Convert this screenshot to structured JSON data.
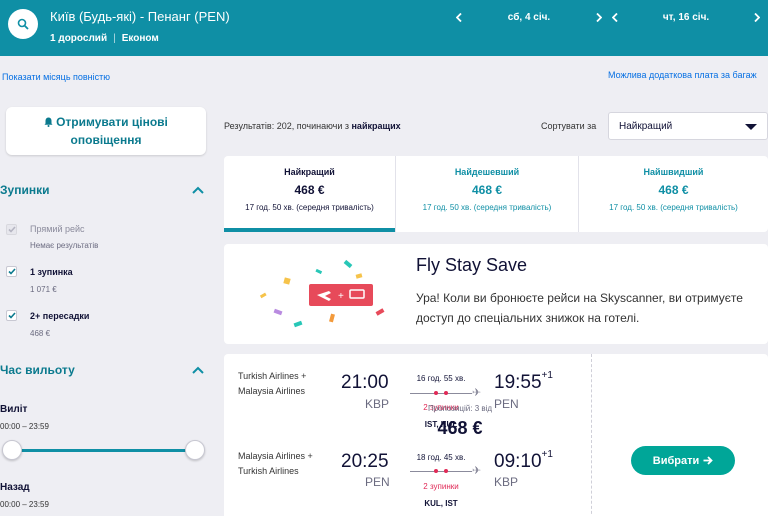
{
  "header": {
    "route": "Київ (Будь-які) - Пенанг (PEN)",
    "passengers": "1 дорослий",
    "cabin": "Економ",
    "outbound_date": "сб, 4 січ.",
    "return_date": "чт, 16 січ."
  },
  "links": {
    "show_month": "Показати місяць повністю",
    "bag_fees": "Можлива додаткова плата за багаж"
  },
  "sidebar": {
    "alert_button": "Отримувати цінові оповіщення",
    "stops_title": "Зупинки",
    "stops": [
      {
        "label": "Прямий рейс",
        "sub": "Немає результатів",
        "checked": true,
        "disabled": true
      },
      {
        "label": "1 зупинка",
        "sub": "1 071 €",
        "checked": true,
        "disabled": false
      },
      {
        "label": "2+ пересадки",
        "sub": "468 €",
        "checked": true,
        "disabled": false
      }
    ],
    "departure_title": "Час вильоту",
    "outbound_label": "Виліт",
    "outbound_range": "00:00 – 23:59",
    "return_label": "Назад",
    "return_range": "00:00 – 23:59"
  },
  "results": {
    "count_prefix": "Результатів: 202, починаючи з ",
    "count_bold": "найкращих",
    "sort_label": "Сортувати за",
    "sort_value": "Найкращий"
  },
  "tabs": [
    {
      "name": "Найкращий",
      "price": "468 €",
      "duration": "17 год. 50 хв. (середня тривалість)"
    },
    {
      "name": "Найдешевший",
      "price": "468 €",
      "duration": "17 год. 50 хв. (середня тривалість)"
    },
    {
      "name": "Найшвидший",
      "price": "468 €",
      "duration": "17 год. 50 хв. (середня тривалість)"
    }
  ],
  "promo": {
    "title": "Fly Stay Save",
    "text": "Ура! Коли ви бронюєте рейси на Skyscanner, ви отримуєте доступ до спеціальних знижок на готелі."
  },
  "result": {
    "legs": [
      {
        "airline": "Turkish Airlines + Malaysia Airlines",
        "dep_time": "21:00",
        "dep_code": "KBP",
        "duration": "16 год. 55 хв.",
        "stops": "2 зупинки",
        "via": "IST, KUL",
        "arr_time": "19:55",
        "arr_offset": "+1",
        "arr_code": "PEN"
      },
      {
        "airline": "Malaysia Airlines + Turkish Airlines",
        "dep_time": "20:25",
        "dep_code": "PEN",
        "duration": "18 год. 45 хв.",
        "stops": "2 зупинки",
        "via": "KUL, IST",
        "arr_time": "09:10",
        "arr_offset": "+1",
        "arr_code": "KBP"
      }
    ],
    "offers": "Пропозицій: 3 від",
    "price": "468 €",
    "select_button": "Вибрати"
  },
  "colors": {
    "brand": "#0f8fa5",
    "cta": "#00a698",
    "stops": "#e02a57",
    "link": "#0770e3"
  }
}
